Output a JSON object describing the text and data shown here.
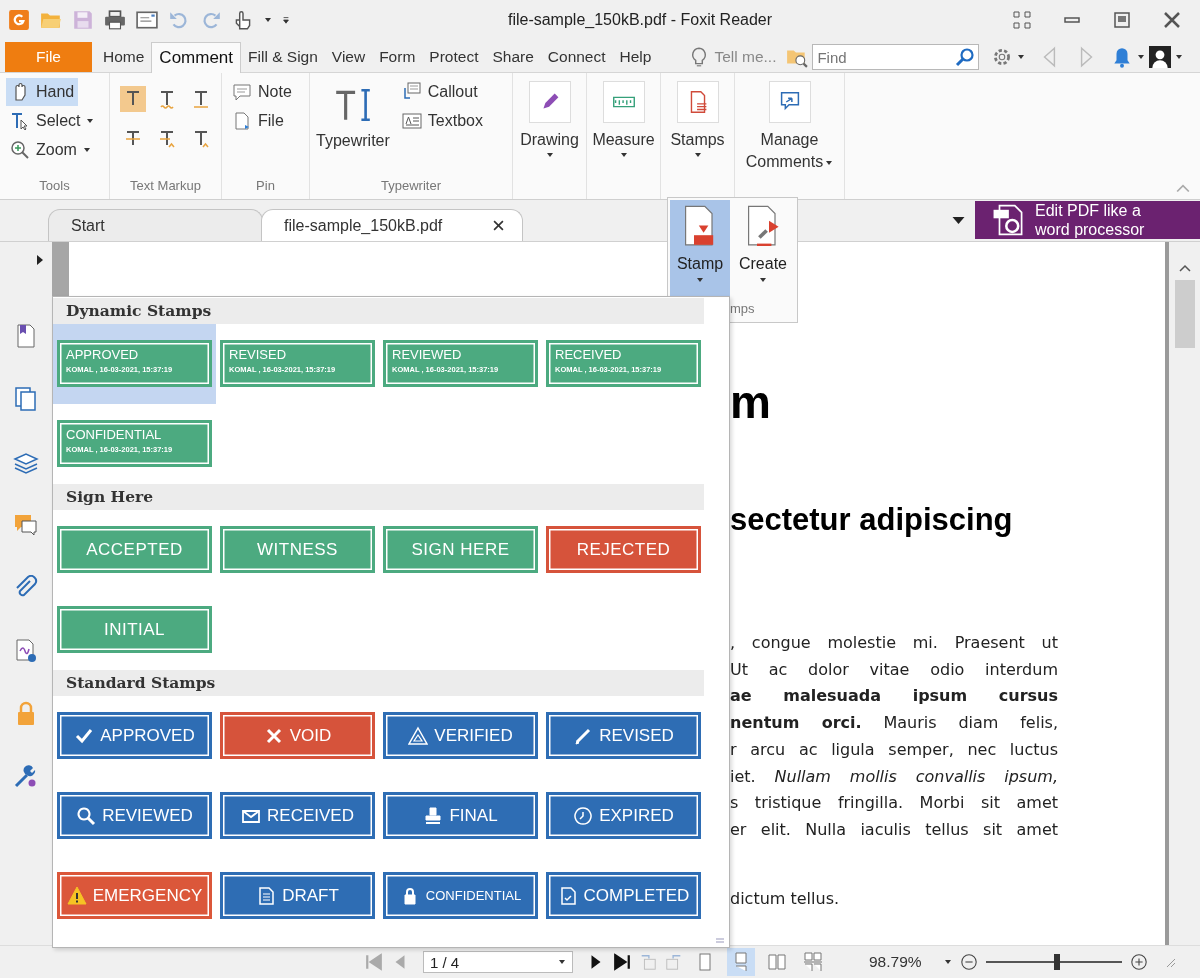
{
  "window": {
    "title": "file-sample_150kB.pdf - Foxit Reader"
  },
  "menu_tabs": [
    {
      "label": "File",
      "kind": "file",
      "selected": false
    },
    {
      "label": "Home",
      "kind": "tab",
      "selected": false
    },
    {
      "label": "Comment",
      "kind": "tab",
      "selected": true
    },
    {
      "label": "Fill & Sign",
      "kind": "tab",
      "selected": false
    },
    {
      "label": "View",
      "kind": "tab",
      "selected": false
    },
    {
      "label": "Form",
      "kind": "tab",
      "selected": false
    },
    {
      "label": "Protect",
      "kind": "tab",
      "selected": false
    },
    {
      "label": "Share",
      "kind": "tab",
      "selected": false
    },
    {
      "label": "Connect",
      "kind": "tab",
      "selected": false
    },
    {
      "label": "Help",
      "kind": "tab",
      "selected": false
    }
  ],
  "tell_me": "Tell me...",
  "search": {
    "placeholder": "Find"
  },
  "ribbon": {
    "tools": {
      "label": "Tools",
      "items": [
        {
          "label": "Hand",
          "selected": true,
          "dropdown": false
        },
        {
          "label": "Select",
          "selected": false,
          "dropdown": true
        },
        {
          "label": "Zoom",
          "selected": false,
          "dropdown": true
        }
      ]
    },
    "text_markup": {
      "label": "Text Markup",
      "buttons": [
        {
          "selected": true
        },
        {
          "selected": false
        },
        {
          "selected": false
        },
        {
          "selected": false
        },
        {
          "selected": false
        },
        {
          "selected": false
        }
      ]
    },
    "pin": {
      "label": "Pin",
      "items": [
        {
          "label": "Note"
        },
        {
          "label": "File"
        }
      ]
    },
    "typewriter": {
      "label": "Typewriter",
      "items": [
        {
          "label": "Typewriter"
        },
        {
          "label": "Callout"
        },
        {
          "label": "Textbox"
        }
      ]
    },
    "large_buttons": [
      {
        "label": "Drawing"
      },
      {
        "label": "Measure"
      },
      {
        "label": "Stamps"
      },
      {
        "label": "Manage Comments"
      }
    ]
  },
  "doc_tabs": [
    {
      "label": "Start",
      "selected": false,
      "closable": false
    },
    {
      "label": "file-sample_150kB.pdf",
      "selected": true,
      "closable": true
    }
  ],
  "promo": {
    "lines": [
      "Edit PDF like a",
      "word processor"
    ]
  },
  "stamp_popup": {
    "buttons": [
      {
        "label": "Stamp",
        "selected": true
      },
      {
        "label": "Create",
        "selected": false
      }
    ],
    "group_label": "mps"
  },
  "document": {
    "heading": "m",
    "subheading": "sectetur adipiscing",
    "paragraph_lines": [
      ", congue molestie mi. Praesent ut",
      "Ut ac dolor vitae odio interdum",
      "**ae malesuada ipsum cursus**",
      "**nentum orci.** Mauris diam felis,",
      "r arcu ac ligula semper, nec luctus",
      "iet. *Nullam mollis convallis ipsum,*",
      "s tristique fringilla. Morbi sit amet",
      "er elit. Nulla iaculis tellus sit amet"
    ],
    "last_line": "dictum tellus."
  },
  "stamp_panel": {
    "sections": [
      {
        "title": "Dynamic Stamps",
        "kind": "dynamic",
        "stamps": [
          {
            "label": "APPROVED",
            "detail": "KOMAL , 16-03-2021, 15:37:19",
            "color": "#4caa80",
            "selected": true
          },
          {
            "label": "REVISED",
            "detail": "KOMAL , 16-03-2021, 15:37:19",
            "color": "#4caa80",
            "selected": false
          },
          {
            "label": "REVIEWED",
            "detail": "KOMAL , 16-03-2021, 15:37:19",
            "color": "#4caa80",
            "selected": false
          },
          {
            "label": "RECEIVED",
            "detail": "KOMAL , 16-03-2021, 15:37:19",
            "color": "#4caa80",
            "selected": false
          },
          {
            "label": "CONFIDENTIAL",
            "detail": "KOMAL , 16-03-2021, 15:37:19",
            "color": "#4caa80",
            "selected": false
          }
        ]
      },
      {
        "title": "Sign Here",
        "kind": "sign",
        "stamps": [
          {
            "label": "ACCEPTED",
            "color": "#4caa80",
            "selected": false
          },
          {
            "label": "WITNESS",
            "color": "#4caa80",
            "selected": false
          },
          {
            "label": "SIGN HERE",
            "color": "#4caa80",
            "selected": false
          },
          {
            "label": "REJECTED",
            "color": "#d6533b",
            "selected": false
          },
          {
            "label": "INITIAL",
            "color": "#4caa80",
            "selected": false
          }
        ]
      },
      {
        "title": "Standard Stamps",
        "kind": "standard",
        "stamps": [
          {
            "label": "APPROVED",
            "color": "#2e6db4",
            "selected": false
          },
          {
            "label": "VOID",
            "color": "#d6533b",
            "selected": false
          },
          {
            "label": "VERIFIED",
            "color": "#2e6db4",
            "selected": false
          },
          {
            "label": "REVISED",
            "color": "#2e6db4",
            "selected": false
          },
          {
            "label": "REVIEWED",
            "color": "#2e6db4",
            "selected": false
          },
          {
            "label": "RECEIVED",
            "color": "#2e6db4",
            "selected": false
          },
          {
            "label": "FINAL",
            "color": "#2e6db4",
            "selected": false
          },
          {
            "label": "EXPIRED",
            "color": "#2e6db4",
            "selected": false
          },
          {
            "label": "EMERGENCY",
            "color": "#db573a",
            "selected": false
          },
          {
            "label": "DRAFT",
            "color": "#2e6db4",
            "selected": false
          },
          {
            "label": "CONFIDENTIAL",
            "color": "#2e6db4",
            "selected": false
          },
          {
            "label": "COMPLETED",
            "color": "#2e6db4",
            "selected": false
          }
        ]
      }
    ]
  },
  "status_bar": {
    "page_field": "1 / 4",
    "view_modes": [
      {
        "selected": false
      },
      {
        "selected": true
      },
      {
        "selected": false
      },
      {
        "selected": false
      }
    ],
    "zoom": {
      "reading": "98.79%",
      "level": 0.5
    }
  }
}
